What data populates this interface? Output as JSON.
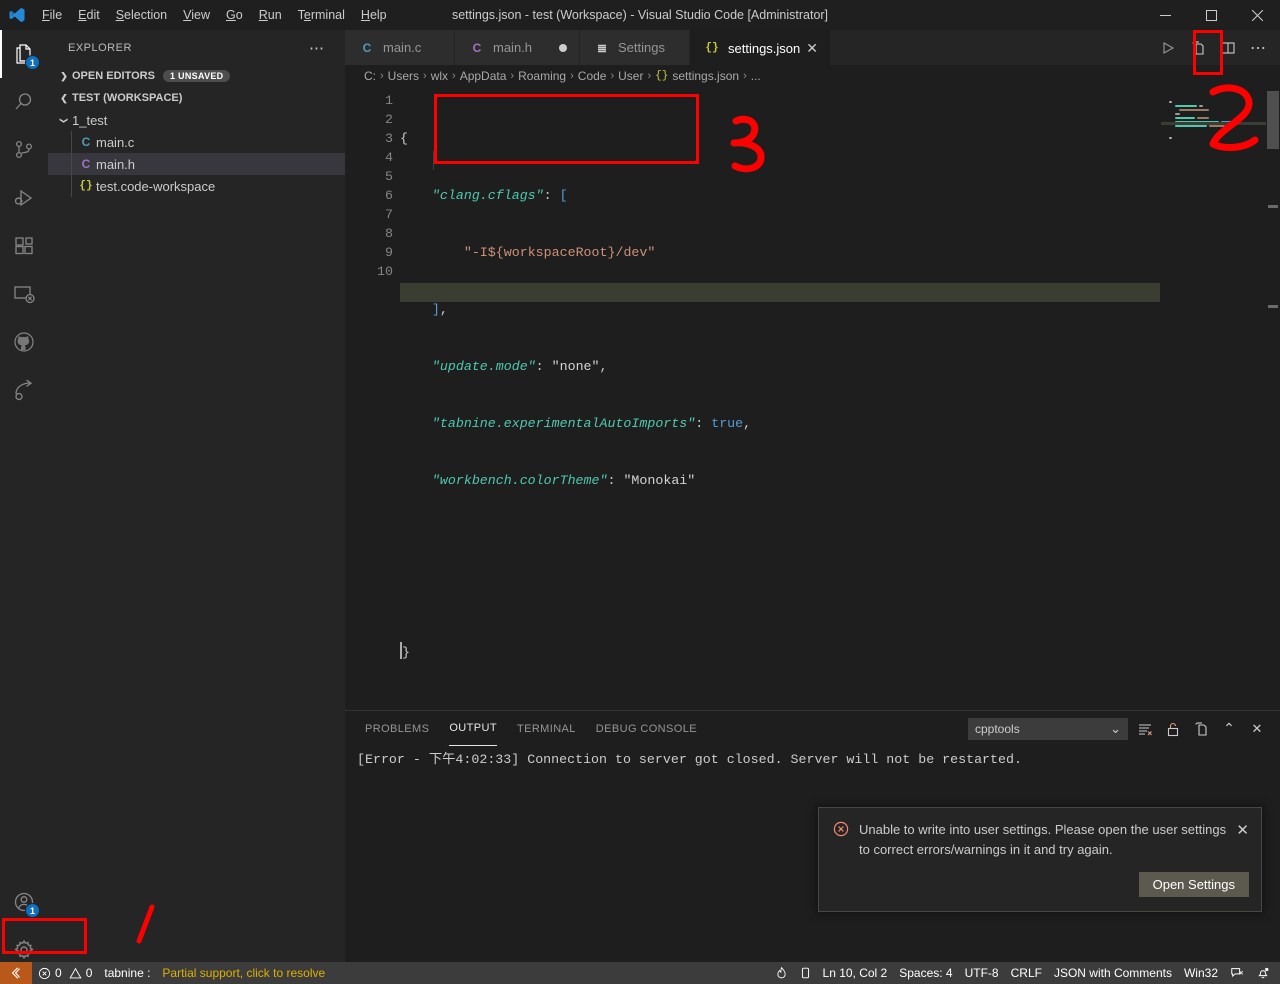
{
  "window": {
    "title": "settings.json - test (Workspace) - Visual Studio Code [Administrator]",
    "minimize_label": "─",
    "maximize_label": "☐",
    "close_label": "✕"
  },
  "menu": {
    "items": [
      {
        "label": "File"
      },
      {
        "label": "Edit"
      },
      {
        "label": "Selection"
      },
      {
        "label": "View"
      },
      {
        "label": "Go"
      },
      {
        "label": "Run"
      },
      {
        "label": "Terminal"
      },
      {
        "label": "Help"
      }
    ]
  },
  "activitybar": {
    "items": [
      {
        "name": "explorer",
        "icon": "files-icon",
        "badge": "1",
        "active": true
      },
      {
        "name": "search",
        "icon": "search-icon",
        "badge": "",
        "active": false
      },
      {
        "name": "source-control",
        "icon": "source-control-icon",
        "badge": "",
        "active": false
      },
      {
        "name": "run-and-debug",
        "icon": "run-debug-icon",
        "badge": "",
        "active": false
      },
      {
        "name": "extensions",
        "icon": "extensions-icon",
        "badge": "",
        "active": false
      },
      {
        "name": "remote-explorer",
        "icon": "remote-explorer-icon",
        "badge": "",
        "active": false
      },
      {
        "name": "github",
        "icon": "github-icon",
        "badge": "",
        "active": false
      },
      {
        "name": "live-share",
        "icon": "live-share-icon",
        "badge": "",
        "active": false
      }
    ],
    "bottom": [
      {
        "name": "accounts",
        "icon": "account-icon",
        "badge": "1"
      },
      {
        "name": "manage",
        "icon": "gear-icon",
        "badge": ""
      }
    ]
  },
  "sidebar": {
    "title": "EXPLORER",
    "more_actions": "⋯",
    "sections": [
      {
        "label": "OPEN EDITORS",
        "expanded": false,
        "badge": "1 UNSAVED"
      },
      {
        "label": "TEST (WORKSPACE)",
        "expanded": true,
        "badge": ""
      }
    ],
    "tree": [
      {
        "label": "1_test",
        "kind": "folder",
        "depth": 1,
        "expanded": true,
        "selected": false,
        "icon": "chevron-down-icon"
      },
      {
        "label": "main.c",
        "kind": "file",
        "depth": 2,
        "expanded": false,
        "selected": false,
        "icon": "c-file-icon"
      },
      {
        "label": "main.h",
        "kind": "file",
        "depth": 2,
        "expanded": false,
        "selected": true,
        "icon": "h-file-icon"
      },
      {
        "label": "test.code-workspace",
        "kind": "file",
        "depth": 2,
        "expanded": false,
        "selected": false,
        "icon": "json-file-icon"
      }
    ]
  },
  "tabs": {
    "items": [
      {
        "label": "main.c",
        "icon": "c-file-icon",
        "active": false,
        "dirty": false,
        "closable": false
      },
      {
        "label": "main.h",
        "icon": "h-file-icon",
        "active": false,
        "dirty": true,
        "closable": false
      },
      {
        "label": "Settings",
        "icon": "settings-tab-icon",
        "active": false,
        "dirty": false,
        "closable": false
      },
      {
        "label": "settings.json",
        "icon": "json-file-icon",
        "active": true,
        "dirty": false,
        "closable": true
      }
    ],
    "close_label": "✕",
    "actions": [
      {
        "name": "run-code-icon",
        "label": "▷"
      },
      {
        "name": "open-changes-icon",
        "label": ""
      },
      {
        "name": "split-editor-icon",
        "label": ""
      },
      {
        "name": "more-actions-icon",
        "label": "⋯"
      }
    ]
  },
  "breadcrumb": {
    "separator": "›",
    "items": [
      "C:",
      "Users",
      "wlx",
      "AppData",
      "Roaming",
      "Code",
      "User",
      "settings.json",
      "..."
    ],
    "file_icon": "{}"
  },
  "editor": {
    "language": "JSON with Comments",
    "line_numbers": [
      "1",
      "2",
      "3",
      "4",
      "5",
      "6",
      "7",
      "8",
      "9",
      "10"
    ],
    "lines": [
      {
        "n": 1,
        "text": "{"
      },
      {
        "n": 2,
        "text": "    \"clang.cflags\": ["
      },
      {
        "n": 3,
        "text": "        \"-I${workspaceRoot}/dev\""
      },
      {
        "n": 4,
        "text": "    ],"
      },
      {
        "n": 5,
        "text": "    \"update.mode\": \"none\","
      },
      {
        "n": 6,
        "text": "    \"tabnine.experimentalAutoImports\": true,"
      },
      {
        "n": 7,
        "text": "    \"workbench.colorTheme\": \"Monokai\""
      },
      {
        "n": 8,
        "text": ""
      },
      {
        "n": 9,
        "text": ""
      },
      {
        "n": 10,
        "text": "}"
      }
    ],
    "tokens": {
      "key_clang": "\"clang.cflags\"",
      "key_update": "\"update.mode\"",
      "key_tabnine": "\"tabnine.experimentalAutoImports\"",
      "key_workbench": "\"workbench.colorTheme\"",
      "val_flag": "\"-I${workspaceRoot}/dev\"",
      "val_none": "\"none\"",
      "val_true": "true",
      "val_monokai": "\"Monokai\""
    }
  },
  "panel": {
    "tabs": [
      {
        "label": "PROBLEMS",
        "active": false
      },
      {
        "label": "OUTPUT",
        "active": true
      },
      {
        "label": "TERMINAL",
        "active": false
      },
      {
        "label": "DEBUG CONSOLE",
        "active": false
      }
    ],
    "channel": "cpptools",
    "chevron": "⌄",
    "actions": [
      {
        "name": "clear-output-icon",
        "label": ""
      },
      {
        "name": "lock-scroll-icon",
        "label": ""
      },
      {
        "name": "open-in-editor-icon",
        "label": ""
      },
      {
        "name": "maximize-panel-icon",
        "label": "⌃"
      },
      {
        "name": "close-panel-icon",
        "label": "✕"
      }
    ],
    "output_text": "[Error - 下午4:02:33] Connection to server got closed. Server will not be restarted."
  },
  "notification": {
    "message": "Unable to write into user settings. Please open the user settings to correct errors/warnings in it and try again.",
    "button": "Open Settings",
    "close": "✕",
    "icon": "error-icon"
  },
  "statusbar": {
    "remote_icon": "remote-indicator-icon",
    "left": [
      {
        "name": "problems",
        "text": "0  0",
        "errors": "0",
        "warnings": "0"
      },
      {
        "name": "tabnine",
        "text": "tabnine :"
      },
      {
        "name": "partial-support",
        "text": "Partial support, click to resolve",
        "warn": true
      }
    ],
    "right": [
      {
        "name": "heat-icon",
        "text": ""
      },
      {
        "name": "battery-icon",
        "text": ""
      },
      {
        "name": "cursor-position",
        "text": "Ln 10, Col 2"
      },
      {
        "name": "indentation",
        "text": "Spaces: 4"
      },
      {
        "name": "encoding",
        "text": "UTF-8"
      },
      {
        "name": "eol",
        "text": "CRLF"
      },
      {
        "name": "language-mode",
        "text": "JSON with Comments"
      },
      {
        "name": "platform",
        "text": "Win32"
      },
      {
        "name": "feedback-icon",
        "text": ""
      },
      {
        "name": "notifications-bell",
        "text": ""
      }
    ]
  },
  "annotations": {
    "marks": [
      {
        "label": "1",
        "kind": "stroke"
      },
      {
        "label": "2",
        "kind": "stroke"
      },
      {
        "label": "3",
        "kind": "stroke"
      }
    ],
    "color": "#fe0000"
  }
}
